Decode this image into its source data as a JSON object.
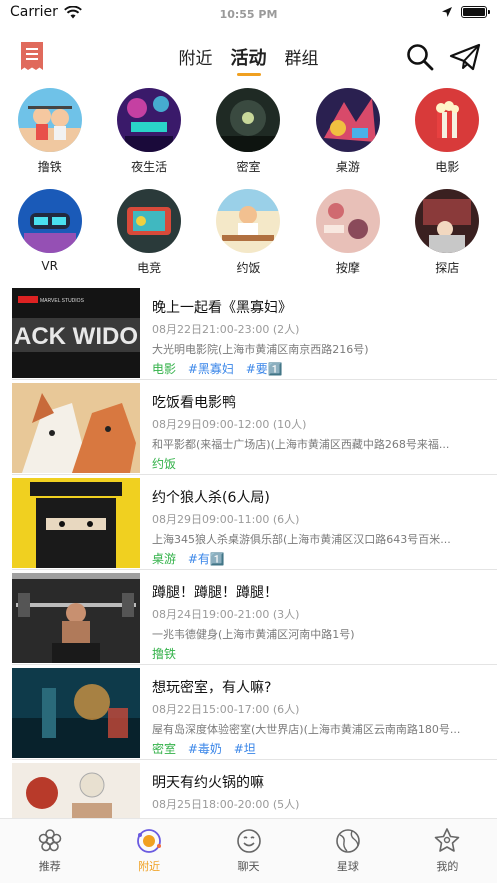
{
  "status": {
    "carrier": "Carrier",
    "time": "10:55 PM"
  },
  "nav": {
    "tabs": [
      {
        "label": "附近",
        "active": false
      },
      {
        "label": "活动",
        "active": true
      },
      {
        "label": "群组",
        "active": false
      }
    ],
    "accent": "#f0a020"
  },
  "categories": [
    {
      "label": "撸铁"
    },
    {
      "label": "夜生活"
    },
    {
      "label": "密室"
    },
    {
      "label": "桌游"
    },
    {
      "label": "电影"
    },
    {
      "label": "VR"
    },
    {
      "label": "电竞"
    },
    {
      "label": "约饭"
    },
    {
      "label": "按摩"
    },
    {
      "label": "探店"
    }
  ],
  "events": [
    {
      "title": "晚上一起看《黑寡妇》",
      "time": "08月22日21:00-23:00 (2人)",
      "place": "大光明电影院(上海市黄浦区南京西路216号)",
      "category": "电影",
      "tags": [
        "#黑寡妇",
        "#要1️⃣"
      ],
      "thumb_text": "ACK WIDO",
      "thumb_brand": "MARVEL STUDIOS"
    },
    {
      "title": "吃饭看电影鸭",
      "time": "08月29日09:00-12:00 (10人)",
      "place": "和平影都(来福士广场店)(上海市黄浦区西藏中路268号来福...",
      "category": "约饭",
      "tags": []
    },
    {
      "title": "约个狼人杀(6人局)",
      "time": "08月29日09:00-11:00 (6人)",
      "place": "上海345狼人杀桌游俱乐部(上海市黄浦区汉口路643号百米...",
      "category": "桌游",
      "tags": [
        "#有1️⃣"
      ]
    },
    {
      "title": "蹲腿！蹲腿！蹲腿！",
      "time": "08月24日19:00-21:00 (3人)",
      "place": "一兆韦德健身(上海市黄浦区河南中路1号)",
      "category": "撸铁",
      "tags": []
    },
    {
      "title": "想玩密室，有人嘛?",
      "time": "08月22日15:00-17:00 (6人)",
      "place": "屋有岛深度体验密室(大世界店)(上海市黄浦区云南南路180号...",
      "category": "密室",
      "tags": [
        "#毒奶",
        "#坦"
      ]
    },
    {
      "title": "明天有约火锅的嘛",
      "time": "08月25日18:00-20:00 (5人)",
      "place": "",
      "category": "",
      "tags": []
    }
  ],
  "bottom_tabs": [
    {
      "label": "推荐",
      "icon": "flower-icon",
      "active": false
    },
    {
      "label": "附近",
      "icon": "nearby-icon",
      "active": true
    },
    {
      "label": "聊天",
      "icon": "chat-icon",
      "active": false
    },
    {
      "label": "星球",
      "icon": "planet-icon",
      "active": false
    },
    {
      "label": "我的",
      "icon": "profile-icon",
      "active": false
    }
  ]
}
